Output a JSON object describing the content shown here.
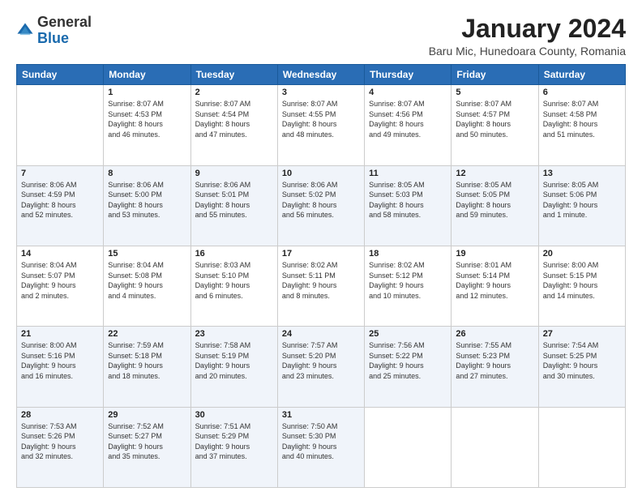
{
  "logo": {
    "general": "General",
    "blue": "Blue"
  },
  "header": {
    "title": "January 2024",
    "location": "Baru Mic, Hunedoara County, Romania"
  },
  "days_of_week": [
    "Sunday",
    "Monday",
    "Tuesday",
    "Wednesday",
    "Thursday",
    "Friday",
    "Saturday"
  ],
  "weeks": [
    [
      {
        "day": "",
        "info": ""
      },
      {
        "day": "1",
        "info": "Sunrise: 8:07 AM\nSunset: 4:53 PM\nDaylight: 8 hours\nand 46 minutes."
      },
      {
        "day": "2",
        "info": "Sunrise: 8:07 AM\nSunset: 4:54 PM\nDaylight: 8 hours\nand 47 minutes."
      },
      {
        "day": "3",
        "info": "Sunrise: 8:07 AM\nSunset: 4:55 PM\nDaylight: 8 hours\nand 48 minutes."
      },
      {
        "day": "4",
        "info": "Sunrise: 8:07 AM\nSunset: 4:56 PM\nDaylight: 8 hours\nand 49 minutes."
      },
      {
        "day": "5",
        "info": "Sunrise: 8:07 AM\nSunset: 4:57 PM\nDaylight: 8 hours\nand 50 minutes."
      },
      {
        "day": "6",
        "info": "Sunrise: 8:07 AM\nSunset: 4:58 PM\nDaylight: 8 hours\nand 51 minutes."
      }
    ],
    [
      {
        "day": "7",
        "info": "Sunrise: 8:06 AM\nSunset: 4:59 PM\nDaylight: 8 hours\nand 52 minutes."
      },
      {
        "day": "8",
        "info": "Sunrise: 8:06 AM\nSunset: 5:00 PM\nDaylight: 8 hours\nand 53 minutes."
      },
      {
        "day": "9",
        "info": "Sunrise: 8:06 AM\nSunset: 5:01 PM\nDaylight: 8 hours\nand 55 minutes."
      },
      {
        "day": "10",
        "info": "Sunrise: 8:06 AM\nSunset: 5:02 PM\nDaylight: 8 hours\nand 56 minutes."
      },
      {
        "day": "11",
        "info": "Sunrise: 8:05 AM\nSunset: 5:03 PM\nDaylight: 8 hours\nand 58 minutes."
      },
      {
        "day": "12",
        "info": "Sunrise: 8:05 AM\nSunset: 5:05 PM\nDaylight: 8 hours\nand 59 minutes."
      },
      {
        "day": "13",
        "info": "Sunrise: 8:05 AM\nSunset: 5:06 PM\nDaylight: 9 hours\nand 1 minute."
      }
    ],
    [
      {
        "day": "14",
        "info": "Sunrise: 8:04 AM\nSunset: 5:07 PM\nDaylight: 9 hours\nand 2 minutes."
      },
      {
        "day": "15",
        "info": "Sunrise: 8:04 AM\nSunset: 5:08 PM\nDaylight: 9 hours\nand 4 minutes."
      },
      {
        "day": "16",
        "info": "Sunrise: 8:03 AM\nSunset: 5:10 PM\nDaylight: 9 hours\nand 6 minutes."
      },
      {
        "day": "17",
        "info": "Sunrise: 8:02 AM\nSunset: 5:11 PM\nDaylight: 9 hours\nand 8 minutes."
      },
      {
        "day": "18",
        "info": "Sunrise: 8:02 AM\nSunset: 5:12 PM\nDaylight: 9 hours\nand 10 minutes."
      },
      {
        "day": "19",
        "info": "Sunrise: 8:01 AM\nSunset: 5:14 PM\nDaylight: 9 hours\nand 12 minutes."
      },
      {
        "day": "20",
        "info": "Sunrise: 8:00 AM\nSunset: 5:15 PM\nDaylight: 9 hours\nand 14 minutes."
      }
    ],
    [
      {
        "day": "21",
        "info": "Sunrise: 8:00 AM\nSunset: 5:16 PM\nDaylight: 9 hours\nand 16 minutes."
      },
      {
        "day": "22",
        "info": "Sunrise: 7:59 AM\nSunset: 5:18 PM\nDaylight: 9 hours\nand 18 minutes."
      },
      {
        "day": "23",
        "info": "Sunrise: 7:58 AM\nSunset: 5:19 PM\nDaylight: 9 hours\nand 20 minutes."
      },
      {
        "day": "24",
        "info": "Sunrise: 7:57 AM\nSunset: 5:20 PM\nDaylight: 9 hours\nand 23 minutes."
      },
      {
        "day": "25",
        "info": "Sunrise: 7:56 AM\nSunset: 5:22 PM\nDaylight: 9 hours\nand 25 minutes."
      },
      {
        "day": "26",
        "info": "Sunrise: 7:55 AM\nSunset: 5:23 PM\nDaylight: 9 hours\nand 27 minutes."
      },
      {
        "day": "27",
        "info": "Sunrise: 7:54 AM\nSunset: 5:25 PM\nDaylight: 9 hours\nand 30 minutes."
      }
    ],
    [
      {
        "day": "28",
        "info": "Sunrise: 7:53 AM\nSunset: 5:26 PM\nDaylight: 9 hours\nand 32 minutes."
      },
      {
        "day": "29",
        "info": "Sunrise: 7:52 AM\nSunset: 5:27 PM\nDaylight: 9 hours\nand 35 minutes."
      },
      {
        "day": "30",
        "info": "Sunrise: 7:51 AM\nSunset: 5:29 PM\nDaylight: 9 hours\nand 37 minutes."
      },
      {
        "day": "31",
        "info": "Sunrise: 7:50 AM\nSunset: 5:30 PM\nDaylight: 9 hours\nand 40 minutes."
      },
      {
        "day": "",
        "info": ""
      },
      {
        "day": "",
        "info": ""
      },
      {
        "day": "",
        "info": ""
      }
    ]
  ]
}
